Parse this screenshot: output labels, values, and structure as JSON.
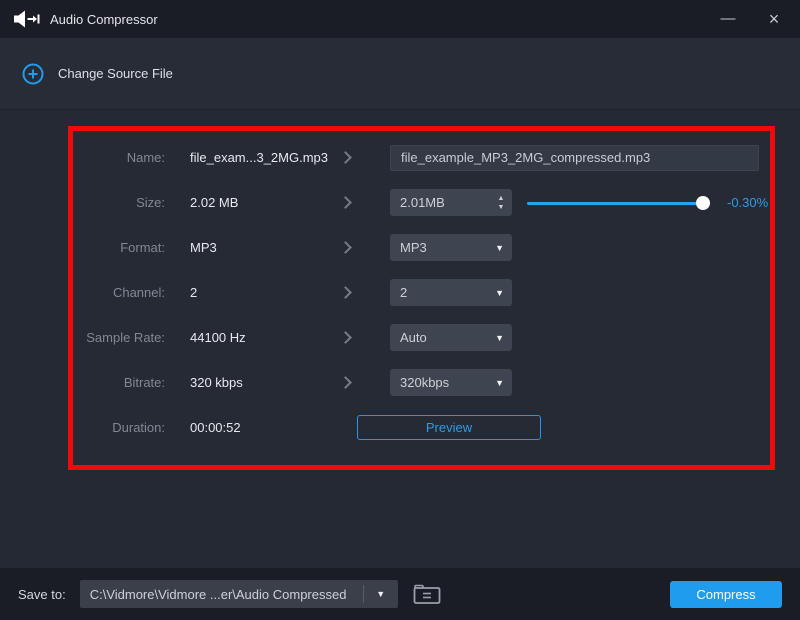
{
  "window": {
    "title": "Audio Compressor",
    "controls": {
      "minimize": "—",
      "close": "×"
    }
  },
  "header": {
    "change_source_label": "Change Source File"
  },
  "panel": {
    "rows": {
      "name": {
        "label": "Name:",
        "value": "file_exam...3_2MG.mp3",
        "output": "file_example_MP3_2MG_compressed.mp3"
      },
      "size": {
        "label": "Size:",
        "value": "2.02 MB",
        "output": "2.01MB",
        "change": "-0.30%"
      },
      "format": {
        "label": "Format:",
        "value": "MP3",
        "selected": "MP3"
      },
      "channel": {
        "label": "Channel:",
        "value": "2",
        "selected": "2"
      },
      "sample_rate": {
        "label": "Sample Rate:",
        "value": "44100 Hz",
        "selected": "Auto"
      },
      "bitrate": {
        "label": "Bitrate:",
        "value": "320 kbps",
        "selected": "320kbps"
      },
      "duration": {
        "label": "Duration:",
        "value": "00:00:52",
        "preview_label": "Preview"
      }
    },
    "highlight_color": "#f00b0b"
  },
  "icons": {
    "dropdown_arrow": "▼",
    "spinner_up": "▲",
    "spinner_down": "▼"
  },
  "footer": {
    "save_to_label": "Save to:",
    "save_path": "C:\\Vidmore\\Vidmore ...er\\Audio Compressed",
    "compress_label": "Compress"
  },
  "colors": {
    "accent_blue": "#1f9ced",
    "slider_blue": "#29a3f1",
    "highlight_red": "#f00b0b"
  }
}
